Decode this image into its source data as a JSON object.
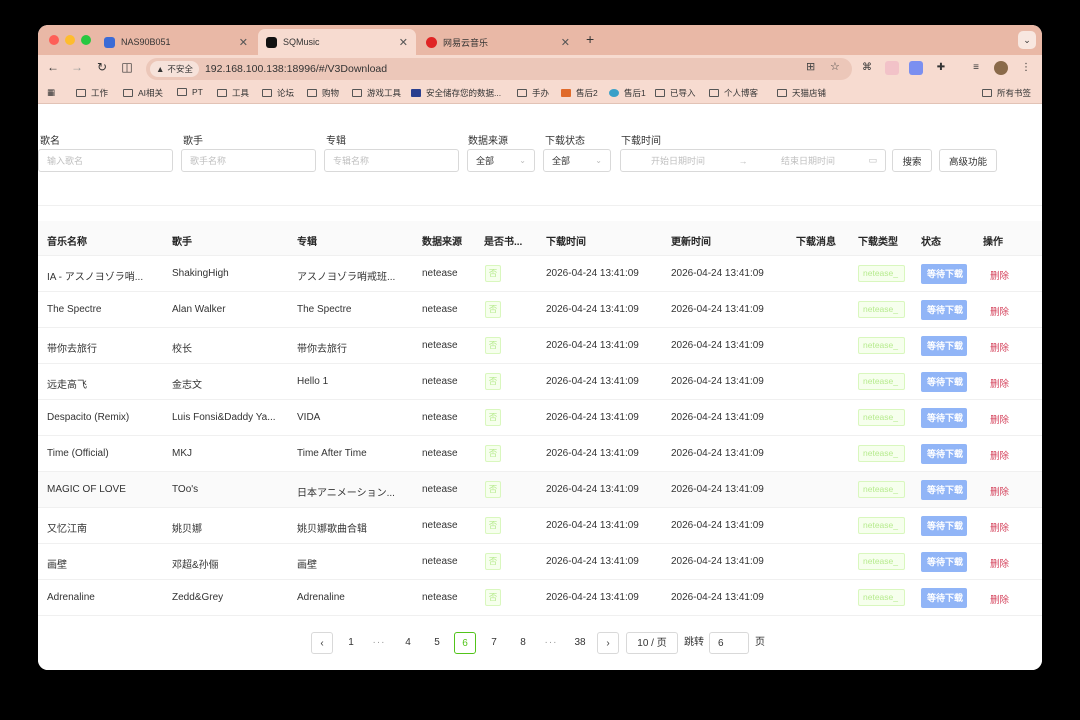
{
  "browser": {
    "tabs": [
      {
        "label": "NAS90B051",
        "icon": "nas-icon",
        "color": "#3b6bd6"
      },
      {
        "label": "SQMusic",
        "icon": "sqmusic-icon",
        "color": "#111111"
      },
      {
        "label": "网易云音乐",
        "icon": "netease-icon",
        "color": "#e02424"
      }
    ],
    "insecure_label": "不安全",
    "url": "192.168.100.138:18996/#/V3Download",
    "bookmarks": [
      "工作",
      "AI相关",
      "PT",
      "工具",
      "论坛",
      "购物",
      "游戏工具",
      "安全储存您的数据...",
      "手办",
      "售后2",
      "售后1",
      "已导入",
      "个人博客",
      "天猫店铺"
    ],
    "all_bookmarks": "所有书签"
  },
  "filters": {
    "song": {
      "label": "歌名",
      "placeholder": "输入歌名"
    },
    "artist": {
      "label": "歌手",
      "placeholder": "歌手名称"
    },
    "album": {
      "label": "专辑",
      "placeholder": "专辑名称"
    },
    "source": {
      "label": "数据来源",
      "value": "全部"
    },
    "status": {
      "label": "下载状态",
      "value": "全部"
    },
    "time": {
      "label": "下载时间",
      "start_placeholder": "开始日期时间",
      "end_placeholder": "结束日期时间"
    },
    "search_button": "搜索",
    "advanced_button": "高级功能"
  },
  "table": {
    "columns": [
      "音乐名称",
      "歌手",
      "专辑",
      "数据来源",
      "是否书...",
      "下载时间",
      "更新时间",
      "下载消息",
      "下载类型",
      "状态",
      "操作"
    ],
    "rows": [
      {
        "name": "IA - アスノヨゾラ哨...",
        "artist": "ShakingHigh",
        "album": "アスノヨゾラ哨戒班...",
        "source": "netease",
        "bookmarked": "否",
        "download_time": "2026-04-24 13:41:09",
        "update_time": "2026-04-24 13:41:09",
        "message": "",
        "type": "netease_",
        "status": "等待下载",
        "action": "删除"
      },
      {
        "name": "The Spectre",
        "artist": "Alan Walker",
        "album": "The Spectre",
        "source": "netease",
        "bookmarked": "否",
        "download_time": "2026-04-24 13:41:09",
        "update_time": "2026-04-24 13:41:09",
        "message": "",
        "type": "netease_",
        "status": "等待下载",
        "action": "删除"
      },
      {
        "name": "带你去旅行",
        "artist": "校长",
        "album": "带你去旅行",
        "source": "netease",
        "bookmarked": "否",
        "download_time": "2026-04-24 13:41:09",
        "update_time": "2026-04-24 13:41:09",
        "message": "",
        "type": "netease_",
        "status": "等待下载",
        "action": "删除"
      },
      {
        "name": "远走高飞",
        "artist": "金志文",
        "album": "Hello 1",
        "source": "netease",
        "bookmarked": "否",
        "download_time": "2026-04-24 13:41:09",
        "update_time": "2026-04-24 13:41:09",
        "message": "",
        "type": "netease_",
        "status": "等待下载",
        "action": "删除"
      },
      {
        "name": "Despacito (Remix)",
        "artist": "Luis Fonsi&Daddy Ya...",
        "album": "VIDA",
        "source": "netease",
        "bookmarked": "否",
        "download_time": "2026-04-24 13:41:09",
        "update_time": "2026-04-24 13:41:09",
        "message": "",
        "type": "netease_",
        "status": "等待下载",
        "action": "删除"
      },
      {
        "name": "Time (Official)",
        "artist": "MKJ",
        "album": "Time After Time",
        "source": "netease",
        "bookmarked": "否",
        "download_time": "2026-04-24 13:41:09",
        "update_time": "2026-04-24 13:41:09",
        "message": "",
        "type": "netease_",
        "status": "等待下载",
        "action": "删除"
      },
      {
        "name": "MAGIC OF LOVE",
        "artist": "TOo's",
        "album": "日本アニメーション...",
        "source": "netease",
        "bookmarked": "否",
        "download_time": "2026-04-24 13:41:09",
        "update_time": "2026-04-24 13:41:09",
        "message": "",
        "type": "netease_",
        "status": "等待下载",
        "action": "删除"
      },
      {
        "name": "又忆江南",
        "artist": "姚贝娜",
        "album": "姚贝娜歌曲合辑",
        "source": "netease",
        "bookmarked": "否",
        "download_time": "2026-04-24 13:41:09",
        "update_time": "2026-04-24 13:41:09",
        "message": "",
        "type": "netease_",
        "status": "等待下载",
        "action": "删除"
      },
      {
        "name": "画壁",
        "artist": "邓超&孙俪",
        "album": "画壁",
        "source": "netease",
        "bookmarked": "否",
        "download_time": "2026-04-24 13:41:09",
        "update_time": "2026-04-24 13:41:09",
        "message": "",
        "type": "netease_",
        "status": "等待下载",
        "action": "删除"
      },
      {
        "name": "Adrenaline",
        "artist": "Zedd&Grey",
        "album": "Adrenaline",
        "source": "netease",
        "bookmarked": "否",
        "download_time": "2026-04-24 13:41:09",
        "update_time": "2026-04-24 13:41:09",
        "message": "",
        "type": "netease_",
        "status": "等待下载",
        "action": "删除"
      }
    ]
  },
  "pagination": {
    "pages": [
      "1",
      "···",
      "4",
      "5",
      "6",
      "7",
      "8",
      "···",
      "38"
    ],
    "current": "6",
    "page_size": "10 / 页",
    "jump_label": "跳转",
    "jump_value": "6",
    "page_suffix": "页"
  }
}
